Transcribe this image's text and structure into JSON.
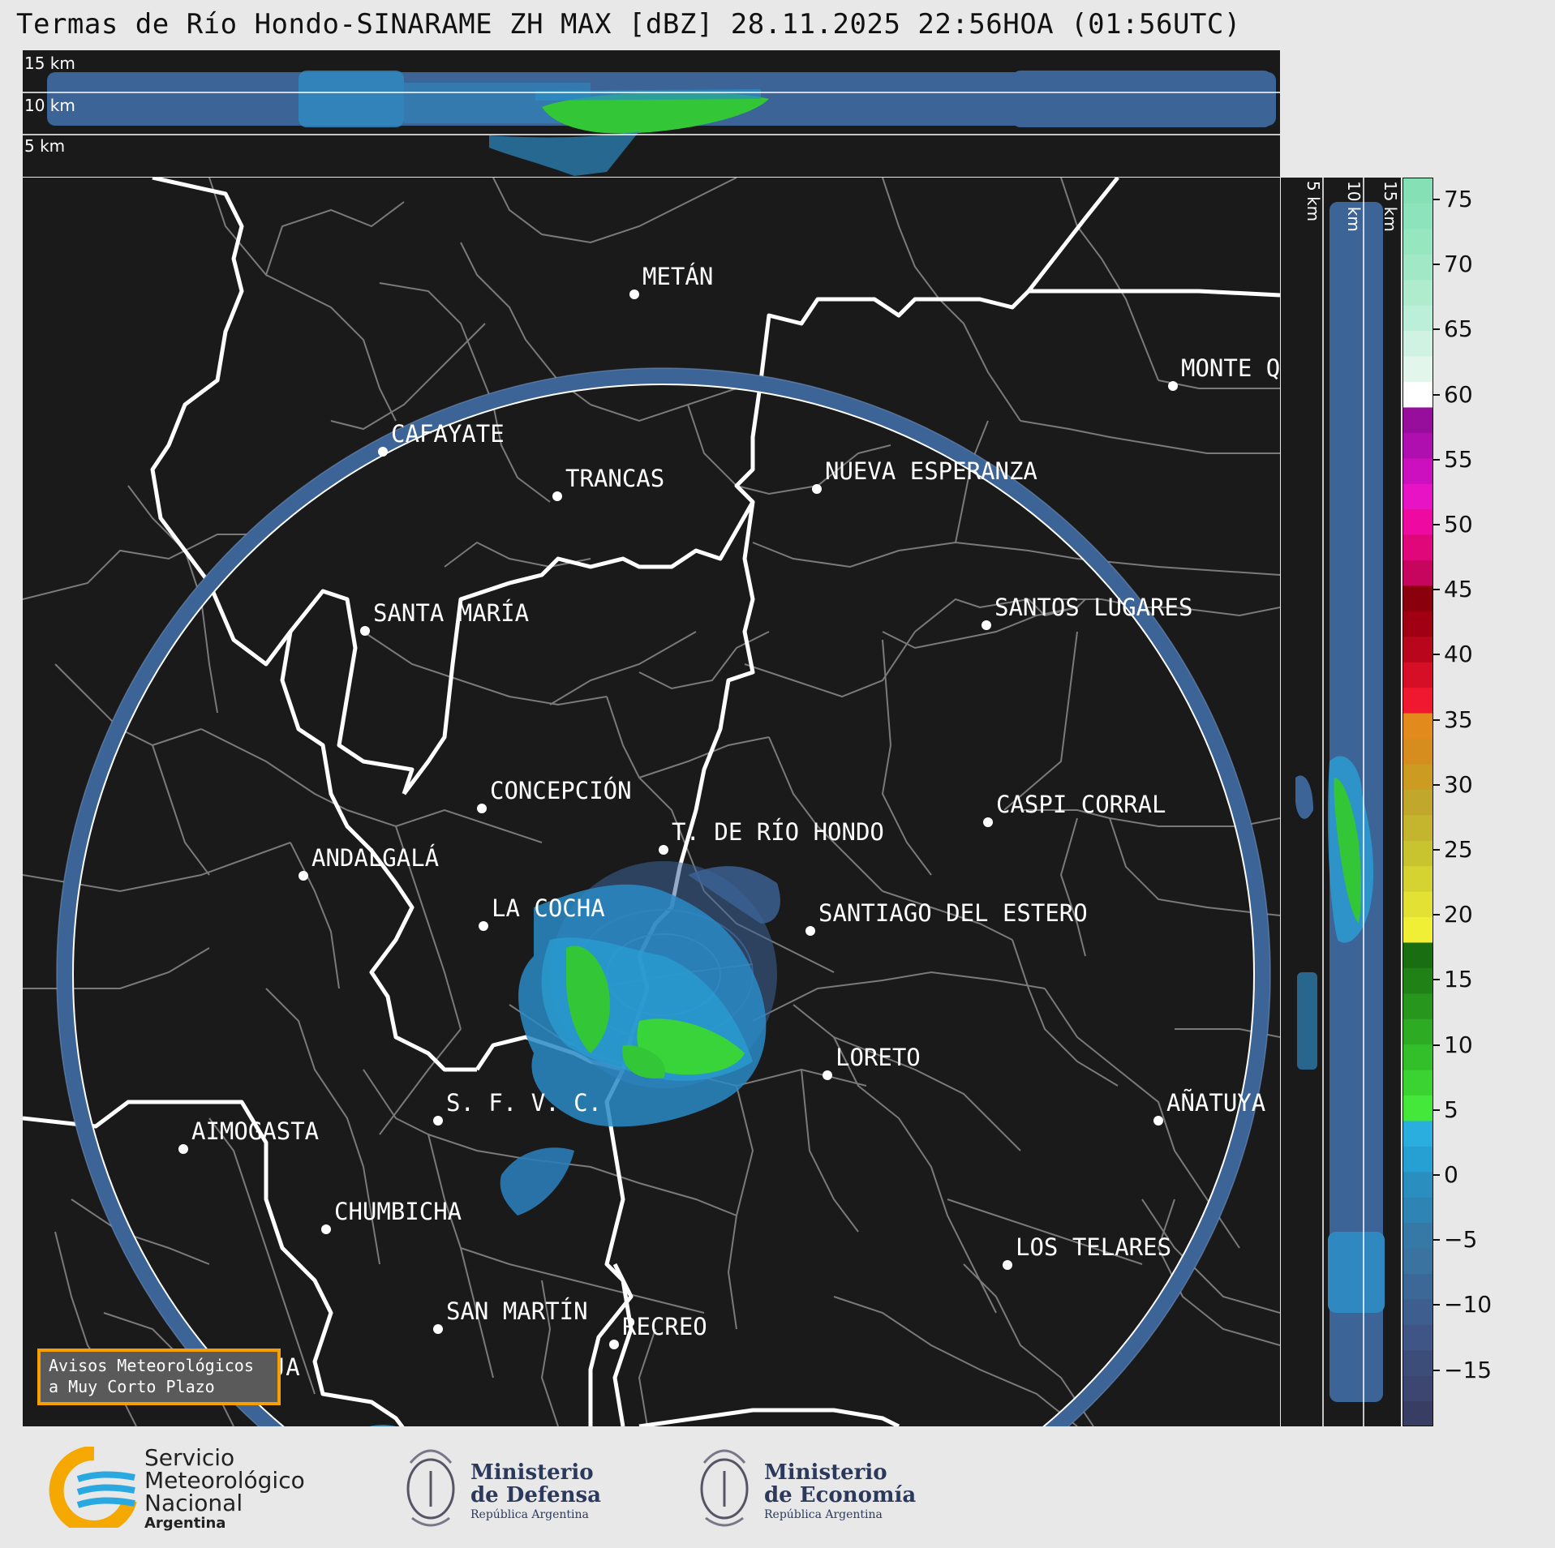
{
  "title": "Termas de Río Hondo-SINARAME ZH MAX [dBZ] 28.11.2025 22:56HOA (01:56UTC)",
  "top_panel": {
    "labels": [
      "15 km",
      "10 km",
      "5 km"
    ]
  },
  "side_panel": {
    "labels": [
      "5 km",
      "10 km",
      "15 km"
    ]
  },
  "colorbar": {
    "ticks": [
      "75",
      "70",
      "65",
      "60",
      "55",
      "50",
      "45",
      "40",
      "35",
      "30",
      "25",
      "20",
      "15",
      "10",
      "5",
      "0",
      "−5",
      "−10",
      "−15"
    ],
    "colors": [
      "#383e63",
      "#3c4670",
      "#3d4d7a",
      "#3e5585",
      "#3e5e8f",
      "#3c6898",
      "#3a72a0",
      "#3678a6",
      "#2e84b2",
      "#2a8fbe",
      "#26a0d2",
      "#2aaee0",
      "#44e83a",
      "#3bd331",
      "#33bf2a",
      "#2cab23",
      "#26961c",
      "#1f8116",
      "#1a6e12",
      "#f0ee35",
      "#e2e134",
      "#d4d332",
      "#c8c430",
      "#c5b52e",
      "#c2a72d",
      "#cc9b22",
      "#d68d1e",
      "#e28a1c",
      "#f0182f",
      "#d60f26",
      "#b8061c",
      "#a00012",
      "#8a000c",
      "#c8055e",
      "#e0077a",
      "#ee0aa0",
      "#e813c4",
      "#cc10bf",
      "#b00fb0",
      "#960e9b",
      "#ffffff",
      "#e2f6ec",
      "#d0f2e2",
      "#bcefd9",
      "#aeeccd",
      "#a0e8c6",
      "#96e6c0",
      "#8de4bc",
      "#85e0b5"
    ]
  },
  "cities": [
    {
      "name": "METÁN"
    },
    {
      "name": "MONTE Q"
    },
    {
      "name": "CAFAYATE"
    },
    {
      "name": "TRANCAS"
    },
    {
      "name": "NUEVA ESPERANZA"
    },
    {
      "name": "SANTA MARÍA"
    },
    {
      "name": "SANTOS LUGARES"
    },
    {
      "name": "CONCEPCIÓN"
    },
    {
      "name": "T. DE RÍO HONDO"
    },
    {
      "name": "CASPI CORRAL"
    },
    {
      "name": "ANDALGALÁ"
    },
    {
      "name": "LA COCHA"
    },
    {
      "name": "SANTIAGO DEL ESTERO"
    },
    {
      "name": "LORETO"
    },
    {
      "name": "S. F. V. C."
    },
    {
      "name": "AÑATUYA"
    },
    {
      "name": "AIMOGASTA"
    },
    {
      "name": "CHUMBICHA"
    },
    {
      "name": "LOS TELARES"
    },
    {
      "name": "SAN MARTÍN"
    },
    {
      "name": "RECREO"
    },
    {
      "name": "LA RIOJA"
    }
  ],
  "aviso": {
    "line1": "Avisos Meteorológicos",
    "line2": "a Muy Corto Plazo"
  },
  "logos": {
    "smn": {
      "line1": "Servicio",
      "line2": "Meteorológico",
      "line3": "Nacional",
      "line4": "Argentina",
      "icon": "smn-logo-icon"
    },
    "defensa": {
      "line1": "Ministerio",
      "line2": "de Defensa",
      "line3": "República Argentina",
      "icon": "argentina-shield-icon"
    },
    "economia": {
      "line1": "Ministerio",
      "line2": "de Economía",
      "line3": "República Argentina",
      "icon": "argentina-shield-icon"
    }
  }
}
